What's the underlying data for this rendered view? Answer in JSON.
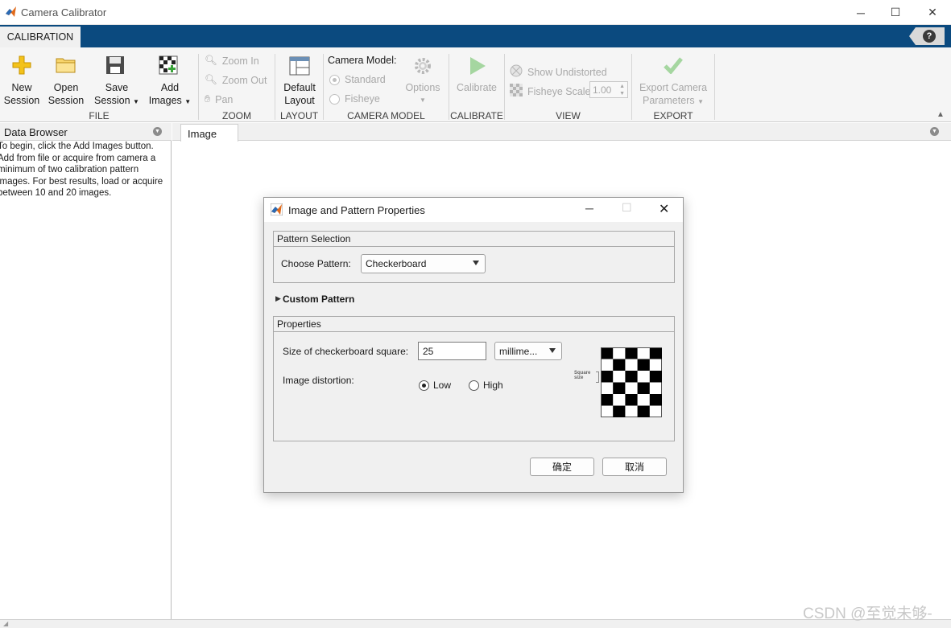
{
  "window": {
    "title": "Camera Calibrator"
  },
  "ribbon": {
    "active_tab": "CALIBRATION",
    "help_label": "?",
    "file": {
      "new_l1": "New",
      "new_l2": "Session",
      "open_l1": "Open",
      "open_l2": "Session",
      "save_l1": "Save",
      "save_l2": "Session",
      "add_l1": "Add",
      "add_l2": "Images",
      "section": "FILE"
    },
    "zoom": {
      "zoom_in": "Zoom In",
      "zoom_out": "Zoom Out",
      "pan": "Pan",
      "section": "ZOOM"
    },
    "layout": {
      "l1": "Default",
      "l2": "Layout",
      "section": "LAYOUT"
    },
    "camera_model": {
      "heading": "Camera Model:",
      "standard": "Standard",
      "fisheye": "Fisheye",
      "options": "Options",
      "section": "CAMERA MODEL"
    },
    "calibrate": {
      "label": "Calibrate",
      "section": "CALIBRATE"
    },
    "view": {
      "show_undistorted": "Show Undistorted",
      "fisheye_scale": "Fisheye Scale",
      "fisheye_value": "1.00",
      "section": "VIEW"
    },
    "export": {
      "l1": "Export Camera",
      "l2": "Parameters",
      "section": "EXPORT"
    }
  },
  "data_browser": {
    "title": "Data Browser",
    "lines": [
      "To begin, click the Add Images button.",
      "Add from file or acquire from camera a",
      "minimum of two calibration pattern",
      "images. For best results, load or acquire",
      "between 10 and 20 images."
    ]
  },
  "image_pane": {
    "tab": "Image"
  },
  "dialog": {
    "title": "Image and Pattern Properties",
    "pattern_group": "Pattern Selection",
    "choose_label": "Choose Pattern:",
    "pattern_value": "Checkerboard",
    "custom_label": "Custom Pattern",
    "props_group": "Properties",
    "size_label": "Size of checkerboard square:",
    "size_value": "25",
    "units_value": "millime...",
    "distortion_label": "Image distortion:",
    "low": "Low",
    "high": "High",
    "distortion_selected": "Low",
    "preview_label_1": "Square",
    "preview_label_2": "size",
    "ok": "确定",
    "cancel": "取消"
  },
  "watermark": "CSDN @至觉未够-",
  "colors": {
    "ribbon_blue": "#0b4a7f",
    "toolstrip": "#f5f5f5",
    "dialog_bg": "#f0f0f0"
  }
}
